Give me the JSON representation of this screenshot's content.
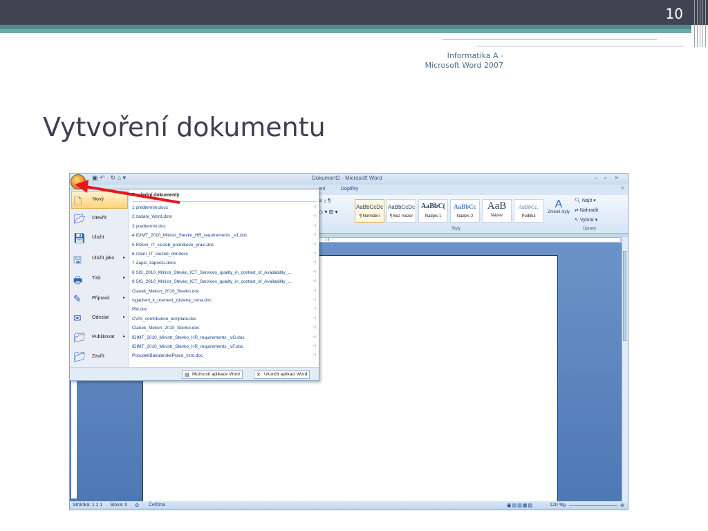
{
  "slide": {
    "number": "10",
    "header_note_line1": "Informatika A -",
    "header_note_line2": "Microsoft Word 2007",
    "title": "Vytvoření dokumentu"
  },
  "word": {
    "window_title": "Dokument2 - Microsoft Word",
    "tabs": [
      "ení",
      "Doplňky"
    ],
    "styles": [
      {
        "sample": "AaBbCcDc",
        "name": "¶ Normální"
      },
      {
        "sample": "AaBbCcDc",
        "name": "¶ Bez mezer"
      },
      {
        "sample": "AaBbC(",
        "name": "Nadpis 1"
      },
      {
        "sample": "AaBbCc",
        "name": "Nadpis 2"
      },
      {
        "sample": "AaB",
        "name": "Název"
      },
      {
        "sample": "AaBbCc.",
        "name": "Podtitul"
      }
    ],
    "change_styles": "Změnit styly",
    "group_styles": "Styly",
    "group_edit": "Úpravy",
    "edit": [
      "Najít",
      "Nahradit",
      "Vybrat"
    ],
    "ruler": "· 7 · ı · 8 · ı · 9 · ı · 10 · ı · 11 · ı · 12 · ı · 13 · ı · 14 · ı · 15 · ı · △ · ı · 17 · ı · 18 ·",
    "status": {
      "page": "Stránka: 1 z 1",
      "words": "Slova: 0",
      "language": "Čeština",
      "zoom": "120 %"
    }
  },
  "office_menu": {
    "items": [
      {
        "label": "Nový",
        "icon": "new-document-icon",
        "submenu": false
      },
      {
        "label": "Otevřít",
        "icon": "open-folder-icon",
        "submenu": false
      },
      {
        "label": "Uložit",
        "icon": "save-icon",
        "submenu": false
      },
      {
        "label": "Uložit jako",
        "icon": "save-as-icon",
        "submenu": true
      },
      {
        "label": "Tisk",
        "icon": "print-icon",
        "submenu": true
      },
      {
        "label": "Připravit",
        "icon": "prepare-icon",
        "submenu": true
      },
      {
        "label": "Odeslat",
        "icon": "send-icon",
        "submenu": true
      },
      {
        "label": "Publikovat",
        "icon": "publish-icon",
        "submenu": true
      },
      {
        "label": "Zavřít",
        "icon": "close-folder-icon",
        "submenu": false
      }
    ],
    "recent_title": "Poslední dokumenty",
    "recent": [
      "1 predtermin.docx",
      "2 zadani_Word.dotx",
      "3 predtermin.doc",
      "4 IDIMT_2010_Ministr_Stevko_HR_requirements _v1.doc",
      "5 Rizeni_IT_sluzeb_podnikove_praxi.doc",
      "6 rizeni_IT_sluzeb_obr.docx",
      "7 Zapis_zapoctu.docx",
      "8 SIS_2010_Ministr_Stevko_ICT_Services_quality_in_context_of_Availability_...",
      "9 SIS_2010_Ministr_Stevko_ICT_Services_quality_in_context_of_Availability_...",
      "Clanek_Mekon_2010_Stevko.doc",
      "vyjadreni_k_oceneni_zjistena_cena.doc",
      "PM.doc",
      "CVIS_contribution_template.doc",
      "Clanek_Mekon_2010_Stevko.doc",
      "IDIMT_2010_Ministr_Stevko_HR_requirements _vG.doc",
      "IDIMT_2010_Ministr_Stevko_HR_requirements _vF.doc",
      "PosudekBakalarskePrace_vzor.doc"
    ],
    "word_options": "Možnosti aplikace Word",
    "exit_word": "Ukončit aplikaci Word"
  },
  "colors": {
    "topbar": "#404450",
    "teal": "#4a8d8e",
    "arrow": "#e8161b",
    "title": "#3c3f55"
  }
}
